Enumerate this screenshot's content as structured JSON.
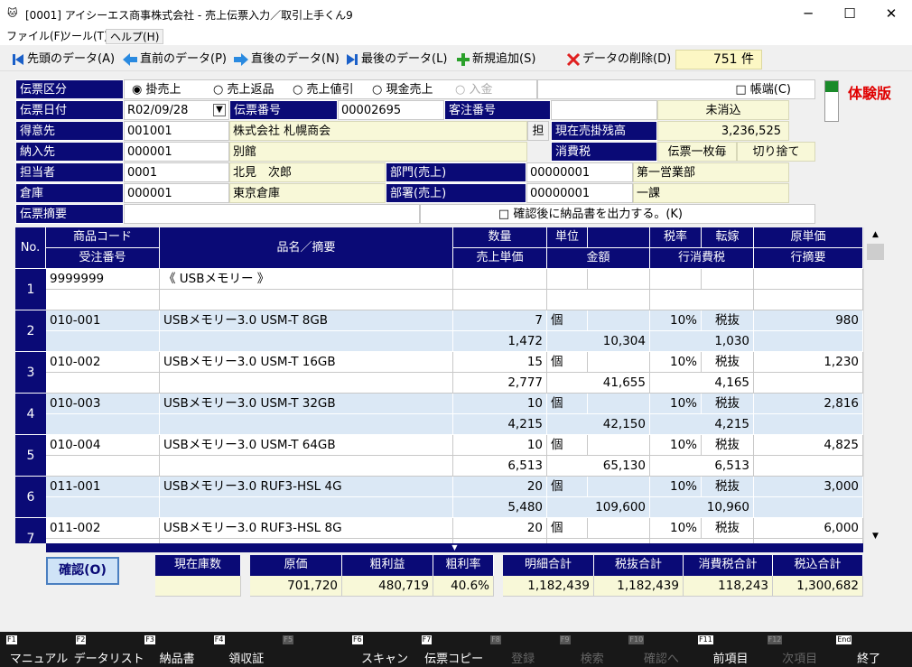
{
  "window": {
    "title": "[0001] アイシーエス商事株式会社 - 売上伝票入力／取引上手くん9",
    "minimize": "─",
    "maximize": "☐",
    "close": "✕"
  },
  "menu": [
    "ファイル(F)",
    "ツール(T)",
    "ヘルプ(H)"
  ],
  "toolbar": {
    "first": "先頭のデータ(A)",
    "prev": "直前のデータ(P)",
    "next": "直後のデータ(N)",
    "last": "最後のデータ(L)",
    "add": "新規追加(S)",
    "delete": "データの削除(D)",
    "count": "751 件"
  },
  "trial_badge": "体験版",
  "header": {
    "denpyo_kubun_label": "伝票区分",
    "kubun_options": [
      "掛売上",
      "売上返品",
      "売上値引",
      "現金売上",
      "入金"
    ],
    "kubun_selected": "掛売上",
    "chouhata": "□ 帳端(C)",
    "date_label": "伝票日付",
    "date_value": "R02/09/28",
    "no_label": "伝票番号",
    "no_value": "00002695",
    "order_label": "客注番号",
    "order_value": "",
    "status": "未消込",
    "customer_label": "得意先",
    "customer_code": "001001",
    "customer_name": "株式会社 札幌商会",
    "tan_button": "担",
    "balance_label": "現在売掛残高",
    "balance_value": "3,236,525",
    "delivery_label": "納入先",
    "delivery_code": "000001",
    "delivery_name": "別館",
    "tax_label": "消費税",
    "tax_mode": "伝票一枚毎",
    "tax_round": "切り捨て",
    "staff_label": "担当者",
    "staff_code": "0001",
    "staff_name": "北見　次郎",
    "dept_label": "部門(売上)",
    "dept_code": "00000001",
    "dept_name": "第一営業部",
    "warehouse_label": "倉庫",
    "warehouse_code": "000001",
    "warehouse_name": "東京倉庫",
    "section_label": "部署(売上)",
    "section_code": "00000001",
    "section_name": "一課",
    "memo_label": "伝票摘要",
    "memo_value": "",
    "confirm_print": "□ 確認後に納品書を出力する。(K)"
  },
  "grid_headers": {
    "no": "No.",
    "code": "商品コード",
    "order_no": "受注番号",
    "name": "品名／摘要",
    "qty": "数量",
    "unit": "単位",
    "price": "売上単価",
    "amount": "金額",
    "taxrate": "税率",
    "tenka": "転嫁",
    "cost": "原単価",
    "rowtax": "行消費税",
    "rowmemo": "行摘要"
  },
  "rows": [
    {
      "no": "1",
      "code": "9999999",
      "order": "",
      "name": "《 USBメモリー 》",
      "qty": "",
      "unit": "",
      "price": "",
      "amount": "",
      "taxrate": "",
      "tenka": "",
      "cost": "",
      "rowtax": "",
      "rowmemo": ""
    },
    {
      "no": "2",
      "code": "010-001",
      "order": "",
      "name": "USBメモリー3.0 USM-T 8GB",
      "qty": "7",
      "unit": "個",
      "price": "1,472",
      "amount": "10,304",
      "taxrate": "10%",
      "tenka": "税抜",
      "cost": "980",
      "rowtax": "1,030",
      "rowmemo": ""
    },
    {
      "no": "3",
      "code": "010-002",
      "order": "",
      "name": "USBメモリー3.0 USM-T 16GB",
      "qty": "15",
      "unit": "個",
      "price": "2,777",
      "amount": "41,655",
      "taxrate": "10%",
      "tenka": "税抜",
      "cost": "1,230",
      "rowtax": "4,165",
      "rowmemo": ""
    },
    {
      "no": "4",
      "code": "010-003",
      "order": "",
      "name": "USBメモリー3.0 USM-T 32GB",
      "qty": "10",
      "unit": "個",
      "price": "4,215",
      "amount": "42,150",
      "taxrate": "10%",
      "tenka": "税抜",
      "cost": "2,816",
      "rowtax": "4,215",
      "rowmemo": ""
    },
    {
      "no": "5",
      "code": "010-004",
      "order": "",
      "name": "USBメモリー3.0 USM-T 64GB",
      "qty": "10",
      "unit": "個",
      "price": "6,513",
      "amount": "65,130",
      "taxrate": "10%",
      "tenka": "税抜",
      "cost": "4,825",
      "rowtax": "6,513",
      "rowmemo": ""
    },
    {
      "no": "6",
      "code": "011-001",
      "order": "",
      "name": "USBメモリー3.0 RUF3-HSL 4G",
      "qty": "20",
      "unit": "個",
      "price": "5,480",
      "amount": "109,600",
      "taxrate": "10%",
      "tenka": "税抜",
      "cost": "3,000",
      "rowtax": "10,960",
      "rowmemo": ""
    },
    {
      "no": "7",
      "code": "011-002",
      "order": "",
      "name": "USBメモリー3.0 RUF3-HSL 8G",
      "qty": "20",
      "unit": "個",
      "price": "",
      "amount": "",
      "taxrate": "10%",
      "tenka": "税抜",
      "cost": "6,000",
      "rowtax": "",
      "rowmemo": ""
    }
  ],
  "confirm_button": "確認(O)",
  "stock": {
    "label": "現在庫数",
    "value": ""
  },
  "profit": {
    "cost_label": "原価",
    "cost_value": "701,720",
    "gross_label": "粗利益",
    "gross_value": "480,719",
    "rate_label": "粗利率",
    "rate_value": "40.6%"
  },
  "totals": {
    "detail_label": "明細合計",
    "detail_value": "1,182,439",
    "excl_label": "税抜合計",
    "excl_value": "1,182,439",
    "tax_label": "消費税合計",
    "tax_value": "118,243",
    "incl_label": "税込合計",
    "incl_value": "1,300,682"
  },
  "fkeys": [
    {
      "key": "F1",
      "label": "マニュアル",
      "enabled": true
    },
    {
      "key": "F2",
      "label": "データリスト",
      "enabled": true
    },
    {
      "key": "F3",
      "label": "納品書",
      "enabled": true
    },
    {
      "key": "F4",
      "label": "領収証",
      "enabled": true
    },
    {
      "key": "F5",
      "label": "",
      "enabled": false
    },
    {
      "key": "F6",
      "label": "スキャン",
      "enabled": true
    },
    {
      "key": "F7",
      "label": "伝票コピー",
      "enabled": true
    },
    {
      "key": "F8",
      "label": "登録",
      "enabled": false
    },
    {
      "key": "F9",
      "label": "検索",
      "enabled": false
    },
    {
      "key": "F10",
      "label": "確認へ",
      "enabled": false
    },
    {
      "key": "F11",
      "label": "前項目",
      "enabled": true
    },
    {
      "key": "F12",
      "label": "次項目",
      "enabled": false
    },
    {
      "key": "End",
      "label": "終了",
      "enabled": true
    }
  ],
  "colors": {
    "header_navy": "#0a0a76",
    "row_alt": "#dbe8f5",
    "yellow_field": "#f8f8d8",
    "trial_red": "#e00000"
  }
}
